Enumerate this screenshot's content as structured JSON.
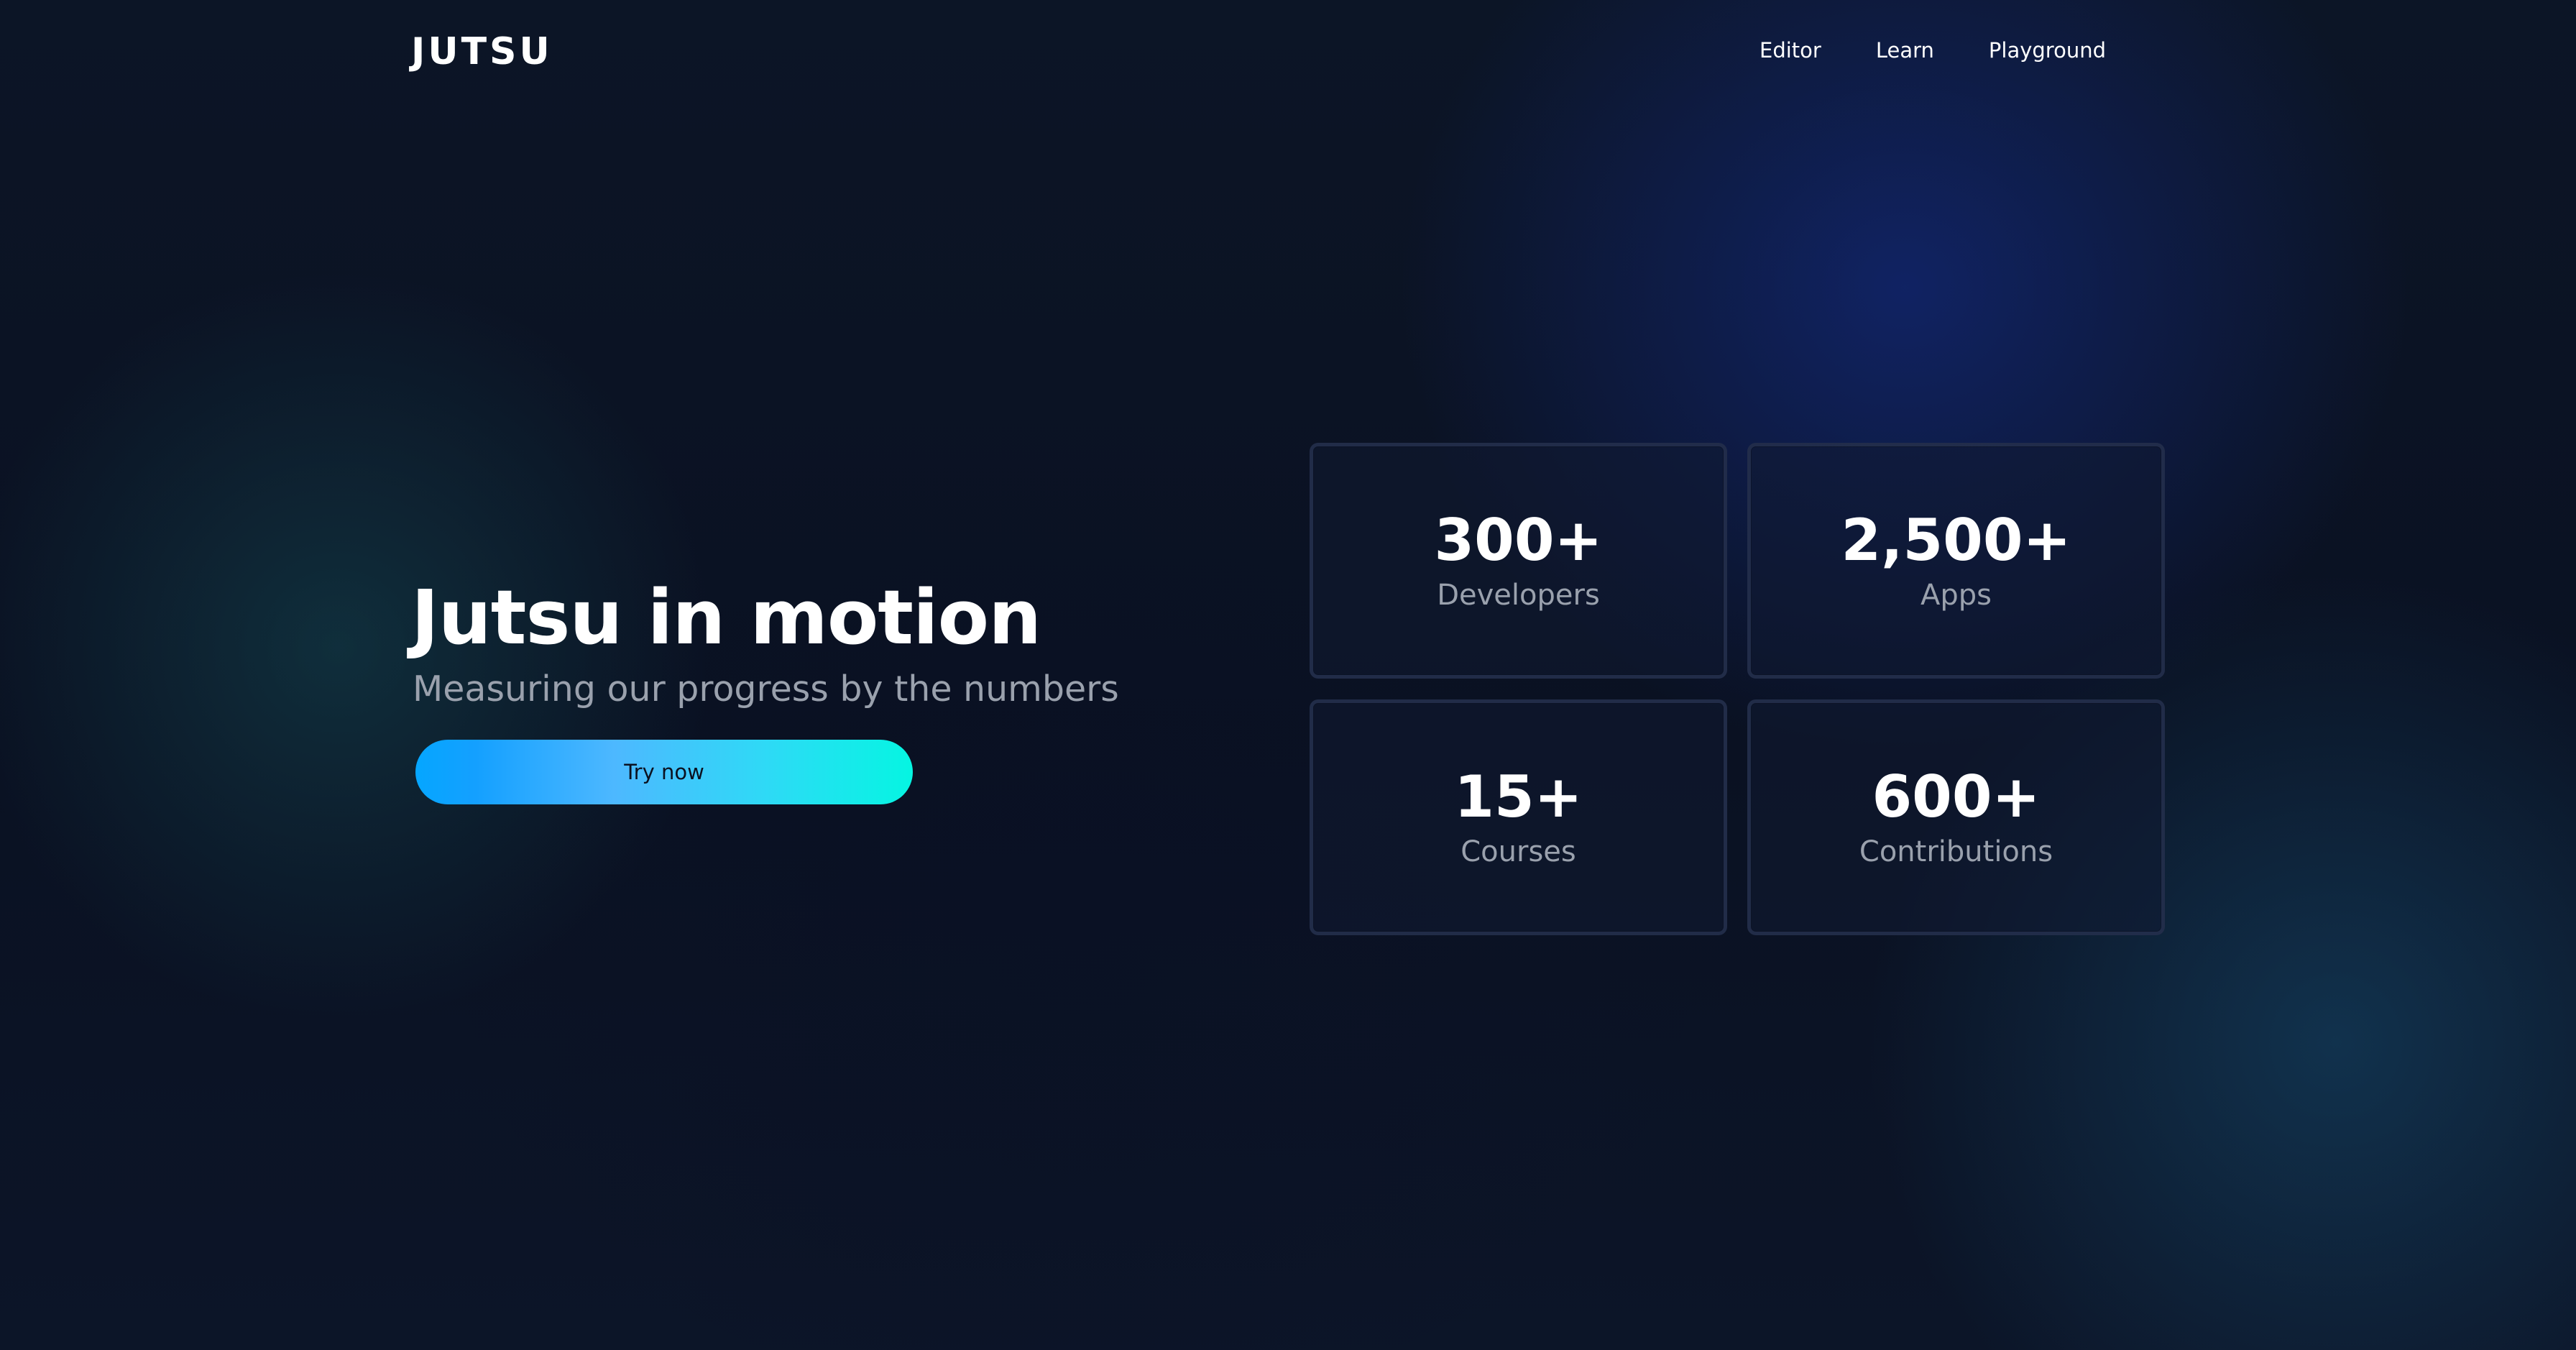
{
  "header": {
    "logo_text": "JUTSU",
    "nav": [
      {
        "label": "Editor"
      },
      {
        "label": "Learn"
      },
      {
        "label": "Playground"
      }
    ]
  },
  "hero": {
    "title": "Jutsu in motion",
    "subtitle": "Measuring our progress by the numbers",
    "cta_label": "Try now"
  },
  "stats": [
    {
      "value": "300+",
      "label": "Developers"
    },
    {
      "value": "2,500+",
      "label": "Apps"
    },
    {
      "value": "15+",
      "label": "Courses"
    },
    {
      "value": "600+",
      "label": "Contributions"
    }
  ],
  "colors": {
    "background": "#0b1120",
    "text_primary": "#ffffff",
    "text_muted": "#9aa1ad",
    "cta_gradient_start": "#05a6ff",
    "cta_gradient_end": "#05f5e2"
  }
}
